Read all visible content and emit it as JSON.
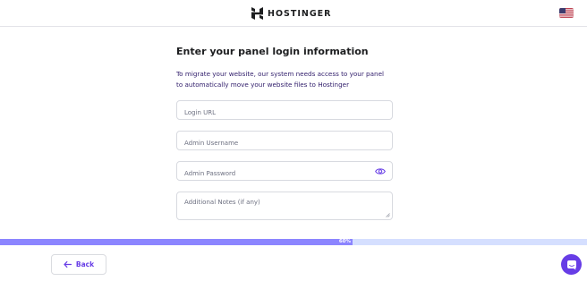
{
  "header": {
    "brand": "HOSTINGER",
    "flag_icon": "us-flag-icon"
  },
  "main": {
    "title": "Enter your panel login information",
    "description": "To migrate your website, our system needs access to your panel to automatically move your website files to Hostinger",
    "fields": {
      "login_url": {
        "placeholder": "Login URL",
        "value": ""
      },
      "admin_username": {
        "placeholder": "Admin Username",
        "value": ""
      },
      "admin_password": {
        "placeholder": "Admin Password",
        "value": "",
        "icon": "eye-icon"
      },
      "notes": {
        "placeholder": "Additional Notes (if any)",
        "value": ""
      }
    }
  },
  "progress": {
    "label": "60%",
    "value": 0.6
  },
  "footer": {
    "back_label": "Back",
    "chat_icon": "chat-icon"
  },
  "colors": {
    "brand": "#673de6",
    "progress_fill": "#8c85ff",
    "progress_track": "#d5dfff"
  }
}
